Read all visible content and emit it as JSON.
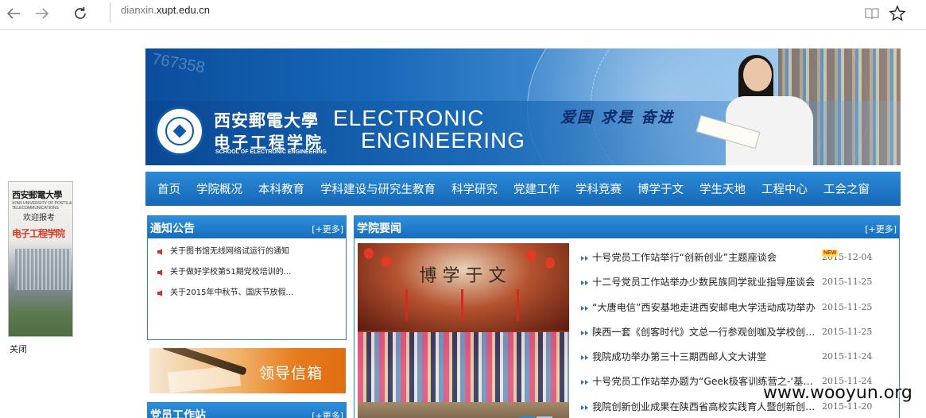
{
  "browser": {
    "back_icon": "arrow-left-icon",
    "forward_icon": "arrow-right-icon",
    "refresh_icon": "refresh-icon",
    "address": {
      "prefix": "dianxin.",
      "domain": "xupt.edu.cn"
    },
    "reading_icon": "book-icon",
    "favorite_icon": "star-icon"
  },
  "float_ad": {
    "line1": "西安郵電大學",
    "line2": "XI'AN UNIVERSITY OF POSTS & TELECOMMUNICATIONS",
    "line3": "欢迎报考",
    "line4": "电子工程学院",
    "close_label": "关闭"
  },
  "banner": {
    "number": "767358",
    "cn_university": "西安郵電大學",
    "cn_school": "电子工程学院",
    "en_sub": "SCHOOL OF ELECTRONIC ENGINEERING",
    "en_line1": "ELECTRONIC",
    "en_line2": "ENGINEERING",
    "slogan": "爱国 求是 奋进"
  },
  "mainnav": {
    "items": [
      "首页",
      "学院概况",
      "本科教育",
      "学科建设与研究生教育",
      "科学研究",
      "党建工作",
      "学科竞赛",
      "博学于文",
      "学生天地",
      "工程中心",
      "工会之窗"
    ]
  },
  "notices": {
    "title": "通知公告",
    "more": "[+更多]",
    "items": [
      "关于图书馆无线网络试运行的通知",
      "关于做好学校第51期党校培训的...",
      "关于2015年中秋节、国庆节放假..."
    ]
  },
  "mailbox": {
    "label": "领导信箱"
  },
  "party": {
    "title": "党员工作站",
    "more": "[+更多]"
  },
  "news": {
    "title": "学院要闻",
    "more": "[+更多]",
    "photo_sign": "博 学 于 文",
    "new_badge": "NEW",
    "items": [
      {
        "title": "十号党员工作站举行“创新创业”主题座谈会",
        "date": "2015-12-04"
      },
      {
        "title": "十二号党员工作站举办少数民族同学就业指导座谈会",
        "date": "2015-11-25"
      },
      {
        "title": "“大唐电信”西安基地走进西安邮电大学活动成功举办",
        "date": "2015-11-25"
      },
      {
        "title": "陕西一套《创客时代》文总一行参观创咖及学校创客空间",
        "date": "2015-11-25"
      },
      {
        "title": "我院成功举办第三十三期西邮人文大讲堂",
        "date": "2015-11-24"
      },
      {
        "title": "十号党员工作站举办题为“Geek极客训练营之-‘基础篇’",
        "date": "2015-11-24"
      },
      {
        "title": "我院创新创业成果在陕西省高校实践育人暨创新创业展",
        "date": "2015-11-20"
      }
    ]
  },
  "watermark": "www.wooyun.org",
  "colors": {
    "nav_blue": "#1e78c8",
    "link_red": "#d52e22",
    "mail_orange": "#e77a1c"
  }
}
